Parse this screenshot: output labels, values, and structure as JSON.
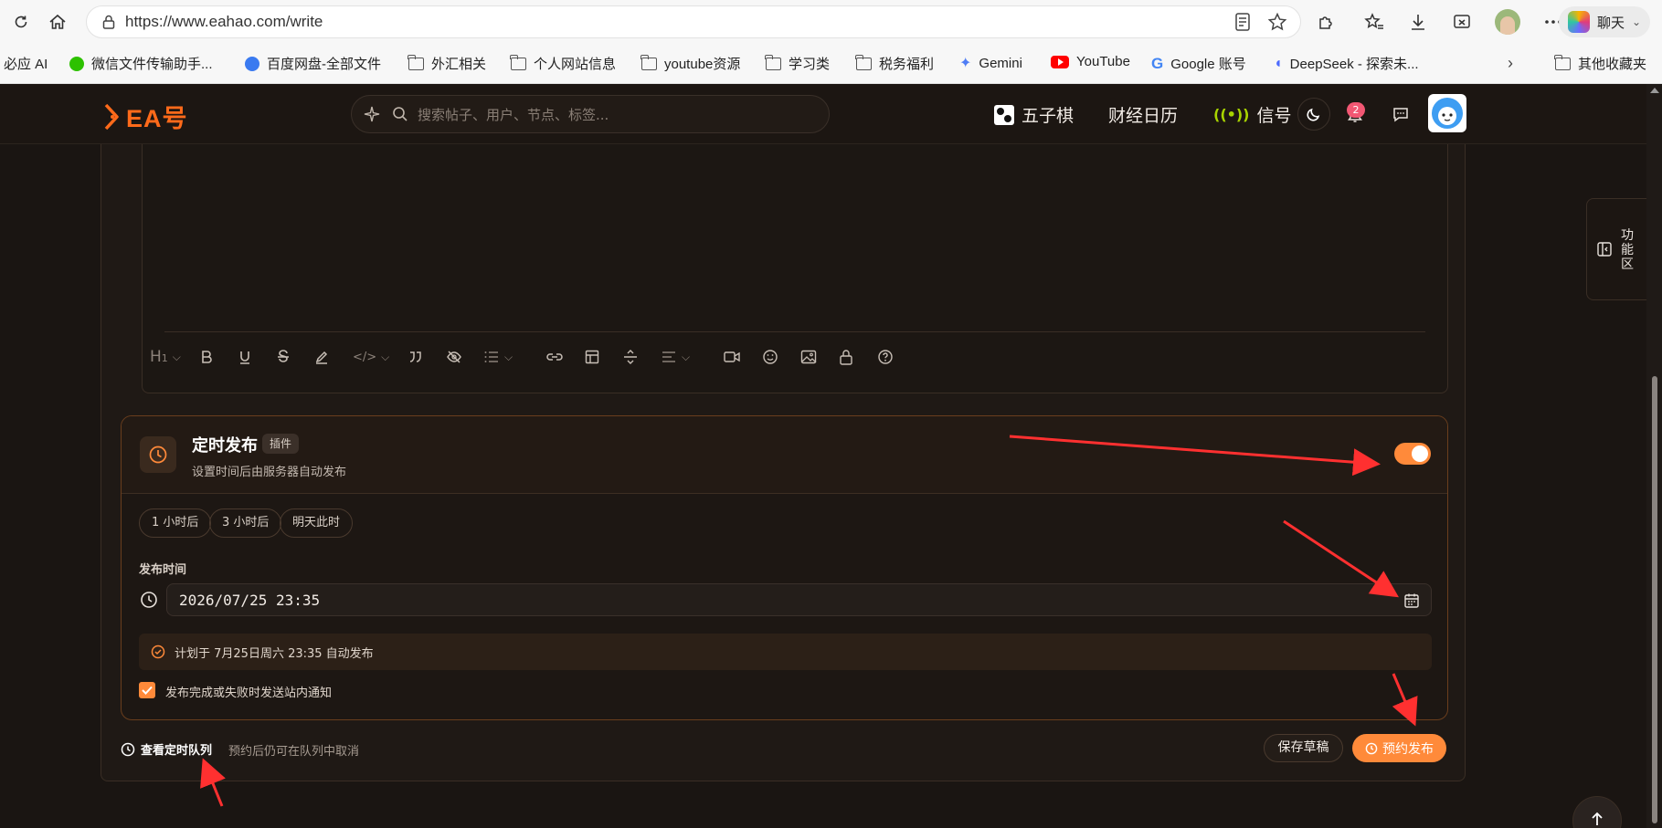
{
  "browser": {
    "url": "https://www.eahao.com/write",
    "chat_label": "聊天"
  },
  "bookmarks": [
    {
      "label": "必应 AI",
      "icon": "bing-icon"
    },
    {
      "label": "微信文件传输助手...",
      "icon": "wechat-icon",
      "color": "#2dc100"
    },
    {
      "label": "百度网盘-全部文件",
      "icon": "baidu-netdisk-icon",
      "color": "#3a7af0"
    },
    {
      "label": "外汇相关",
      "icon": "folder-icon"
    },
    {
      "label": "个人网站信息",
      "icon": "folder-icon"
    },
    {
      "label": "youtube资源",
      "icon": "folder-icon"
    },
    {
      "label": "学习类",
      "icon": "folder-icon"
    },
    {
      "label": "税务福利",
      "icon": "folder-icon"
    },
    {
      "label": "Gemini",
      "icon": "gemini-icon",
      "color": "#4f7df5"
    },
    {
      "label": "YouTube",
      "icon": "youtube-icon",
      "color": "#ff0000"
    },
    {
      "label": "Google 账号",
      "icon": "google-icon",
      "color": "#4285f4"
    },
    {
      "label": "DeepSeek - 探索未...",
      "icon": "deepseek-icon",
      "color": "#4d6bfe"
    }
  ],
  "bookmarks_other": "其他收藏夹",
  "site": {
    "logo_text": "EA号",
    "search_placeholder": "搜索帖子、用户、节点、标签...",
    "nav": {
      "gomoku": "五子棋",
      "calendar": "财经日历",
      "signal": "信号"
    },
    "notification_count": "2"
  },
  "side_panel": {
    "label": "功能区"
  },
  "schedule": {
    "title": "定时发布",
    "tag": "插件",
    "subtitle": "设置时间后由服务器自动发布",
    "enabled": true,
    "quick_options": [
      "1 小时后",
      "3 小时后",
      "明天此时"
    ],
    "time_label": "发布时间",
    "datetime_value": "2026/07/25  23:35",
    "plan_text": "计划于 7月25日周六 23:35 自动发布",
    "notify_checked": true,
    "notify_label": "发布完成或失败时发送站内通知"
  },
  "footer": {
    "queue_link": "查看定时队列",
    "queue_note": "预约后仍可在队列中取消",
    "save_draft": "保存草稿",
    "schedule_publish": "预约发布"
  },
  "colors": {
    "accent": "#ff8a3a",
    "brand": "#ff6a1a",
    "annotation_arrow": "#ff3030",
    "background": "#1a1512"
  }
}
